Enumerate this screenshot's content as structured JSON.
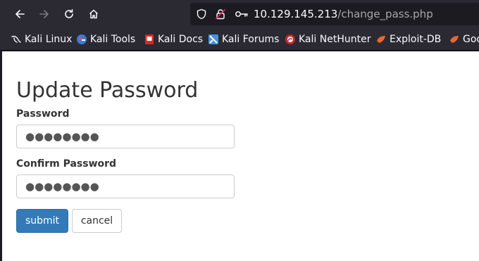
{
  "browser": {
    "url_host": "10.129.145.213",
    "url_path": "/change_pass.php",
    "bookmarks": [
      {
        "label": "Kali Linux",
        "icon": "kali-dragon-icon"
      },
      {
        "label": "Kali Tools",
        "icon": "kali-tools-icon"
      },
      {
        "label": "Kali Docs",
        "icon": "kali-docs-icon"
      },
      {
        "label": "Kali Forums",
        "icon": "kali-forums-icon"
      },
      {
        "label": "Kali NetHunter",
        "icon": "kali-nethunter-icon"
      },
      {
        "label": "Exploit-DB",
        "icon": "exploit-db-icon"
      },
      {
        "label": "Goo",
        "icon": "exploit-db-icon"
      }
    ]
  },
  "form": {
    "title": "Update Password",
    "password_label": "Password",
    "password_value": "●●●●●●●●",
    "confirm_label": "Confirm Password",
    "confirm_value": "●●●●●●●●",
    "submit_label": "submit",
    "cancel_label": "cancel"
  },
  "colors": {
    "chrome_bg": "#2b2a33",
    "primary_button": "#337ab7"
  }
}
